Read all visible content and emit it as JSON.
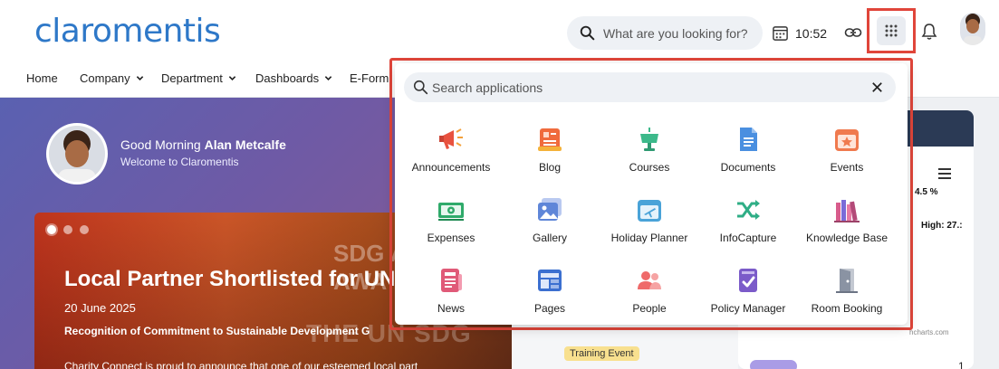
{
  "header": {
    "logo_text": "claromentis",
    "search_placeholder": "What are you looking for?",
    "clock_time": "10:52",
    "accent_color": "#2e78c8",
    "highlight_color": "#e0453a"
  },
  "nav": {
    "items": [
      {
        "label": "Home"
      },
      {
        "label": "Company"
      },
      {
        "label": "Department"
      },
      {
        "label": "Dashboards"
      },
      {
        "label": "E-Form"
      }
    ]
  },
  "greeting": {
    "prefix": "Good Morning ",
    "name": "Alan Metcalfe",
    "subtitle": "Welcome to Claromentis"
  },
  "news": {
    "title": "Local Partner Shortlisted for UN SI",
    "date": "20 June 2025",
    "subtitle": "Recognition of Commitment to Sustainable Development G",
    "body": "Charity Connect is proud to announce that one of our esteemed local part",
    "bg_text_1": "SDG A",
    "bg_text_2": "AWA",
    "bg_text_3": "THE UN SDG"
  },
  "background": {
    "training_tag": "Training Event",
    "pct_text": "4.5 %",
    "high_text": "High: 27.:",
    "credit_text": "hcharts.com",
    "count_text": "1"
  },
  "apps_dropdown": {
    "search_placeholder": "Search applications",
    "apps": [
      {
        "label": "Announcements",
        "icon": "megaphone-icon",
        "color": "#e8523f"
      },
      {
        "label": "Blog",
        "icon": "blog-icon",
        "color": "#f06b3d"
      },
      {
        "label": "Courses",
        "icon": "courses-icon",
        "color": "#3cb98a"
      },
      {
        "label": "Documents",
        "icon": "document-icon",
        "color": "#4a8fe0"
      },
      {
        "label": "Events",
        "icon": "calendar-star-icon",
        "color": "#f07a4e"
      },
      {
        "label": "Expenses",
        "icon": "money-icon",
        "color": "#2faa6a"
      },
      {
        "label": "Gallery",
        "icon": "gallery-icon",
        "color": "#5f86d8"
      },
      {
        "label": "Holiday Planner",
        "icon": "plane-calendar-icon",
        "color": "#4aa3d8"
      },
      {
        "label": "InfoCapture",
        "icon": "shuffle-icon",
        "color": "#2fae86"
      },
      {
        "label": "Knowledge Base",
        "icon": "books-icon",
        "color": "#d85c8c"
      },
      {
        "label": "News",
        "icon": "news-icon",
        "color": "#e05a78"
      },
      {
        "label": "Pages",
        "icon": "pages-icon",
        "color": "#3b6fd0"
      },
      {
        "label": "People",
        "icon": "people-icon",
        "color": "#ef6a6a"
      },
      {
        "label": "Policy Manager",
        "icon": "policy-check-icon",
        "color": "#7b5bc9"
      },
      {
        "label": "Room Booking",
        "icon": "door-icon",
        "color": "#8a93a3"
      }
    ]
  }
}
